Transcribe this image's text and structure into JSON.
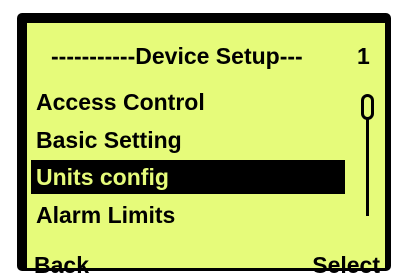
{
  "screen": {
    "title": "-----------Device Setup---",
    "page_number": "1",
    "menu_items": [
      {
        "label": "Access Control"
      },
      {
        "label": "Basic Setting"
      },
      {
        "label": "Units config"
      },
      {
        "label": "Alarm Limits"
      }
    ],
    "selected_index": 2,
    "softkeys": {
      "left": "Back",
      "right": "Select"
    }
  },
  "colors": {
    "lcd_background": "#e6fb7a",
    "lcd_foreground": "#000000",
    "frame": "#000000"
  }
}
